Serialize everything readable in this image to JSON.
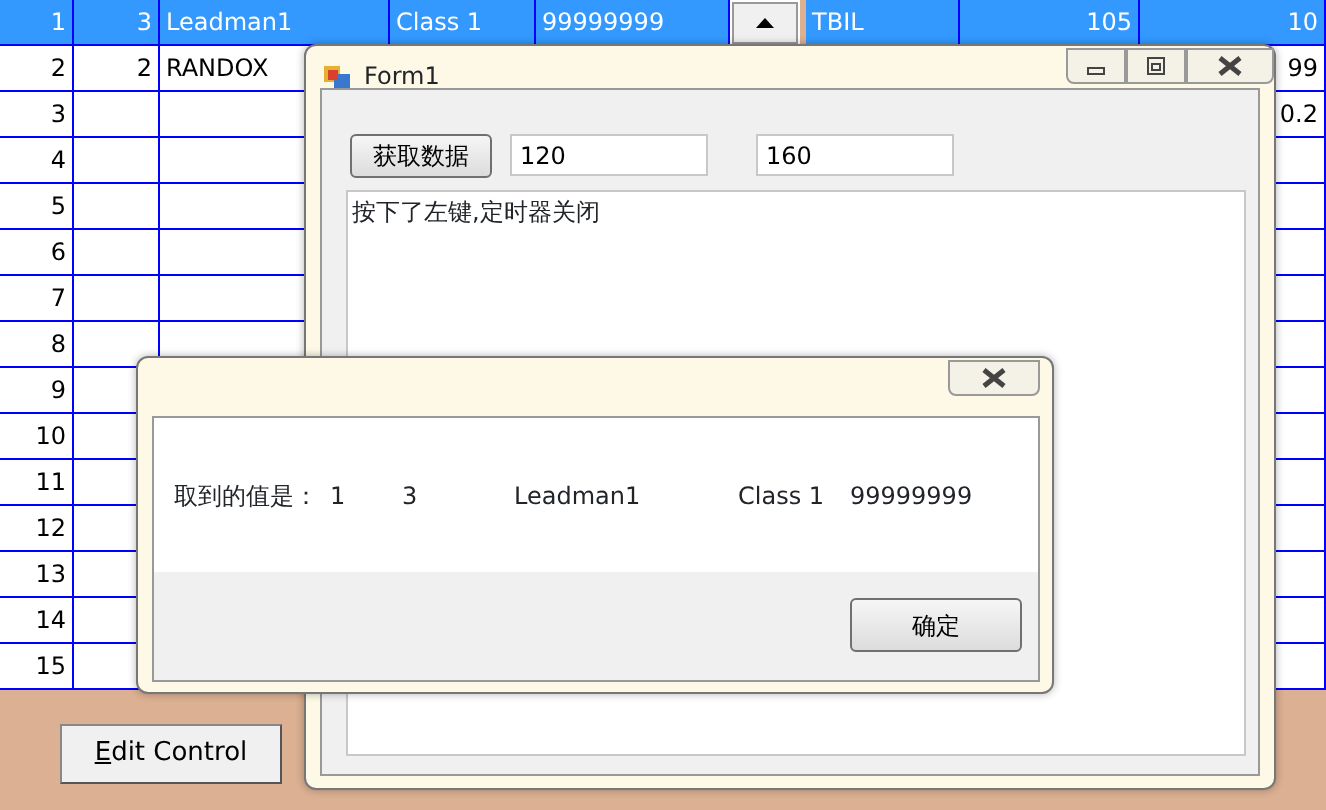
{
  "grid": {
    "rows": [
      {
        "selected": true,
        "cells": {
          "number": "1",
          "column_2": "3",
          "column_3": "Leadman1",
          "column_4": "Class 1",
          "column_5": "99999999",
          "column_8": "TBIL",
          "column_9": "105",
          "column_10": "10"
        }
      },
      {
        "selected": false,
        "cells": {
          "number": "2",
          "column_2": "2",
          "column_3": "RANDOX",
          "column_10": "99"
        }
      },
      {
        "selected": false,
        "cells": {
          "number": "3",
          "column_10": "0.2"
        }
      },
      {
        "selected": false,
        "cells": {
          "number": "4"
        }
      },
      {
        "selected": false,
        "cells": {
          "number": "5"
        }
      },
      {
        "selected": false,
        "cells": {
          "number": "6"
        }
      },
      {
        "selected": false,
        "cells": {
          "number": "7"
        }
      },
      {
        "selected": false,
        "cells": {
          "number": "8"
        }
      },
      {
        "selected": false,
        "cells": {
          "number": "9"
        }
      },
      {
        "selected": false,
        "cells": {
          "number": "10"
        }
      },
      {
        "selected": false,
        "cells": {
          "number": "11"
        }
      },
      {
        "selected": false,
        "cells": {
          "number": "12"
        }
      },
      {
        "selected": false,
        "cells": {
          "number": "13"
        }
      },
      {
        "selected": false,
        "cells": {
          "number": "14"
        }
      },
      {
        "selected": false,
        "cells": {
          "number": "15"
        }
      }
    ]
  },
  "edit_button": "Edit Control",
  "form_window": {
    "title": "Form1",
    "fetch_button": "获取数据",
    "field_1": "120",
    "field_2": "160",
    "log_text": "按下了左键,定时器关闭"
  },
  "message_box": {
    "parts": [
      "取到的值是：",
      "1",
      "3",
      "Leadman1",
      "Class 1",
      "99999999"
    ],
    "ok_button": "确定"
  }
}
